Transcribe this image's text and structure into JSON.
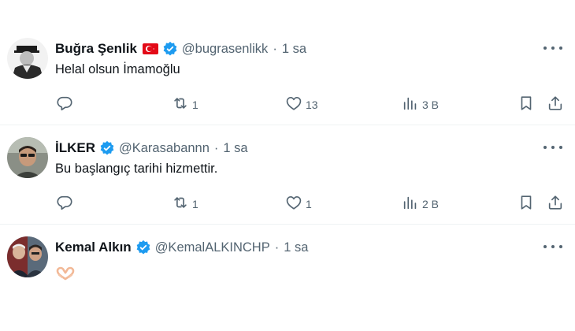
{
  "tweets": [
    {
      "name": "Buğra Şenlik",
      "handle": "@bugrasenlikk",
      "time": "1 sa",
      "text": "Helal olsun İmamoğlu",
      "replies": "",
      "reposts": "1",
      "likes": "13",
      "views": "3 B",
      "has_flag": true
    },
    {
      "name": "İLKER",
      "handle": "@Karasabannn",
      "time": "1 sa",
      "text": "Bu başlangıç tarihi hizmettir.",
      "replies": "",
      "reposts": "1",
      "likes": "1",
      "views": "2 B",
      "has_flag": false
    },
    {
      "name": "Kemal Alkın",
      "handle": "@KemalALKINCHP",
      "time": "1 sa",
      "text": "🫶",
      "emoji_icon": "heart-hands-icon",
      "has_flag": false
    }
  ],
  "separator": "·",
  "colors": {
    "text": "#0f1419",
    "secondary": "#536471",
    "verified": "#1d9bf0",
    "divider": "#eff3f4",
    "flag_red": "#e30a17"
  },
  "icons": {
    "reply": "reply-icon",
    "repost": "repost-icon",
    "like": "heart-icon",
    "views": "views-icon",
    "bookmark": "bookmark-icon",
    "share": "share-icon",
    "more": "more-icon",
    "verified": "verified-badge-icon",
    "flag": "turkey-flag-icon"
  }
}
